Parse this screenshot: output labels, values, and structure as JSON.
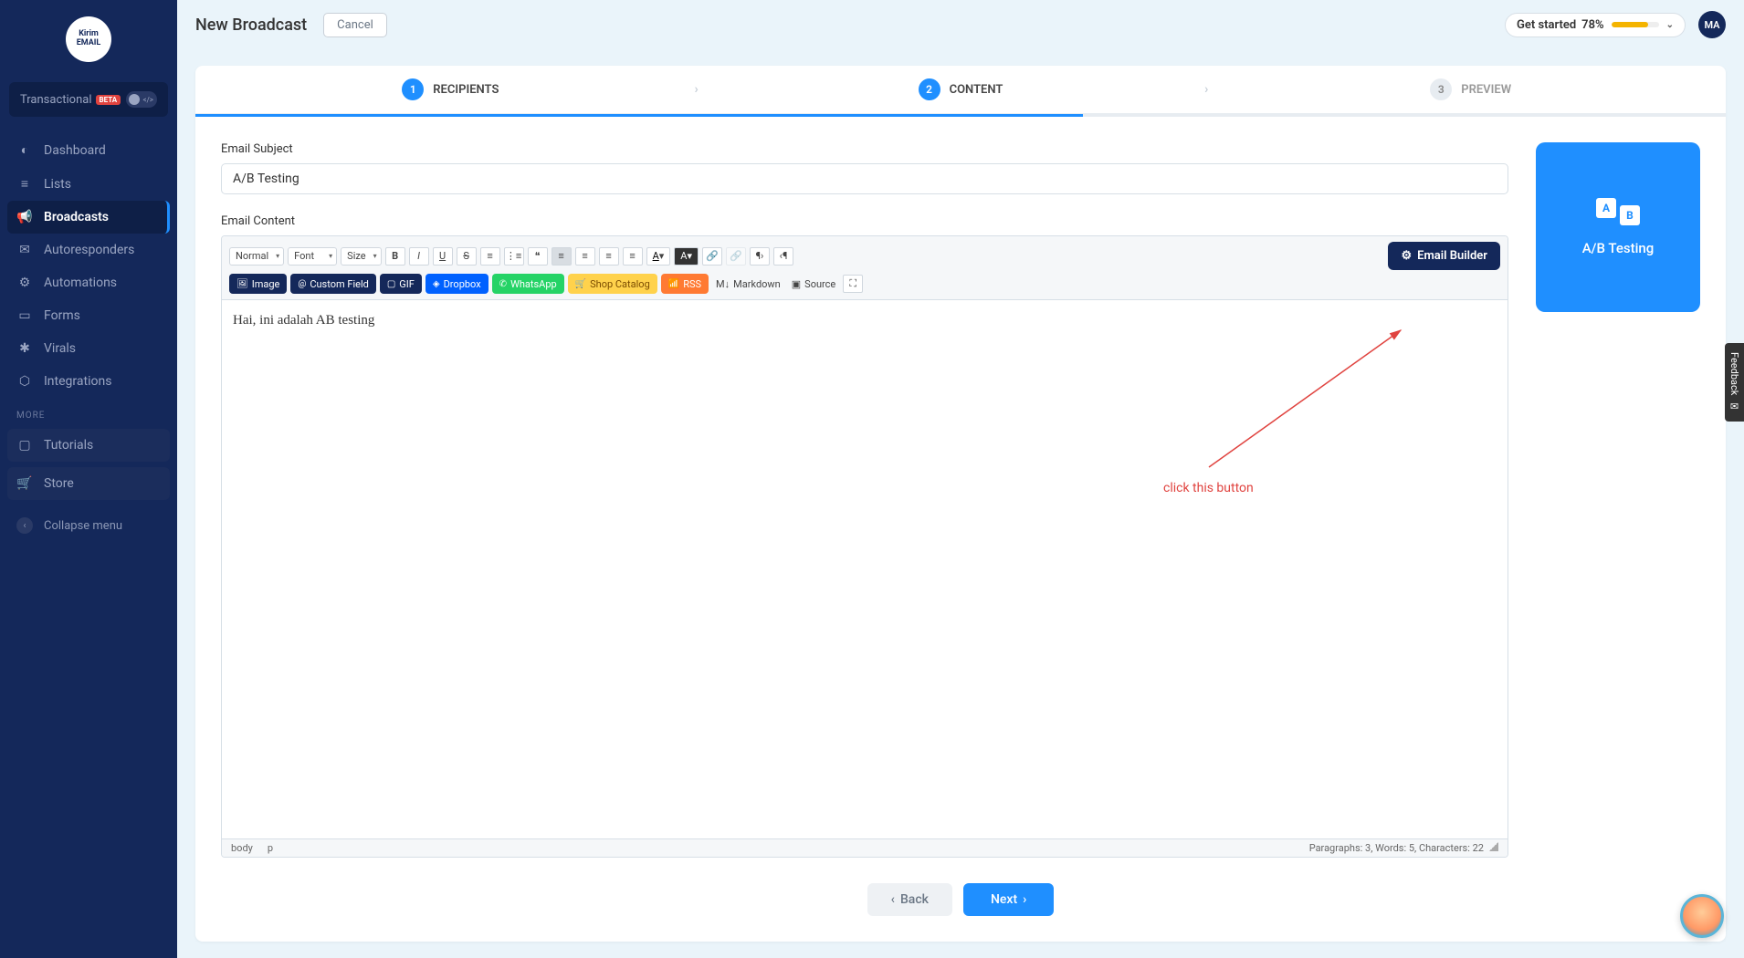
{
  "logo_text": "Kirim\nEMAIL",
  "transactional": {
    "label": "Transactional",
    "badge": "BETA"
  },
  "sidebar": {
    "items": [
      {
        "label": "Dashboard",
        "icon": "◐"
      },
      {
        "label": "Lists",
        "icon": "≡"
      },
      {
        "label": "Broadcasts",
        "icon": "📢"
      },
      {
        "label": "Autoresponders",
        "icon": "✉"
      },
      {
        "label": "Automations",
        "icon": "⚙"
      },
      {
        "label": "Forms",
        "icon": "▭"
      },
      {
        "label": "Virals",
        "icon": "✱"
      },
      {
        "label": "Integrations",
        "icon": "⬡"
      }
    ],
    "more_label": "MORE",
    "tutorials": "Tutorials",
    "store": "Store",
    "collapse": "Collapse menu"
  },
  "header": {
    "title": "New Broadcast",
    "cancel": "Cancel",
    "getstarted_label": "Get started",
    "getstarted_pct": "78%",
    "avatar": "MA"
  },
  "stepper": {
    "s1": {
      "n": "1",
      "label": "RECIPIENTS"
    },
    "s2": {
      "n": "2",
      "label": "CONTENT"
    },
    "s3": {
      "n": "3",
      "label": "PREVIEW"
    }
  },
  "form": {
    "subject_label": "Email Subject",
    "subject_value": "A/B Testing",
    "content_label": "Email Content"
  },
  "toolbar": {
    "normal": "Normal",
    "font": "Font",
    "size": "Size",
    "image": "Image",
    "custom_field": "Custom Field",
    "gif": "GIF",
    "dropbox": "Dropbox",
    "whatsapp": "WhatsApp",
    "shop": "Shop Catalog",
    "rss": "RSS",
    "markdown": "Markdown",
    "source": "Source",
    "email_builder": "Email Builder"
  },
  "editor": {
    "body_text": "Hai, ini adalah AB testing",
    "path_body": "body",
    "path_p": "p",
    "stats": "Paragraphs: 3, Words: 5, Characters: 22"
  },
  "ab": {
    "label": "A/B Testing",
    "a": "A",
    "b": "B"
  },
  "annotation": "click this button",
  "nav": {
    "back": "Back",
    "next": "Next"
  },
  "feedback": "Feedback"
}
